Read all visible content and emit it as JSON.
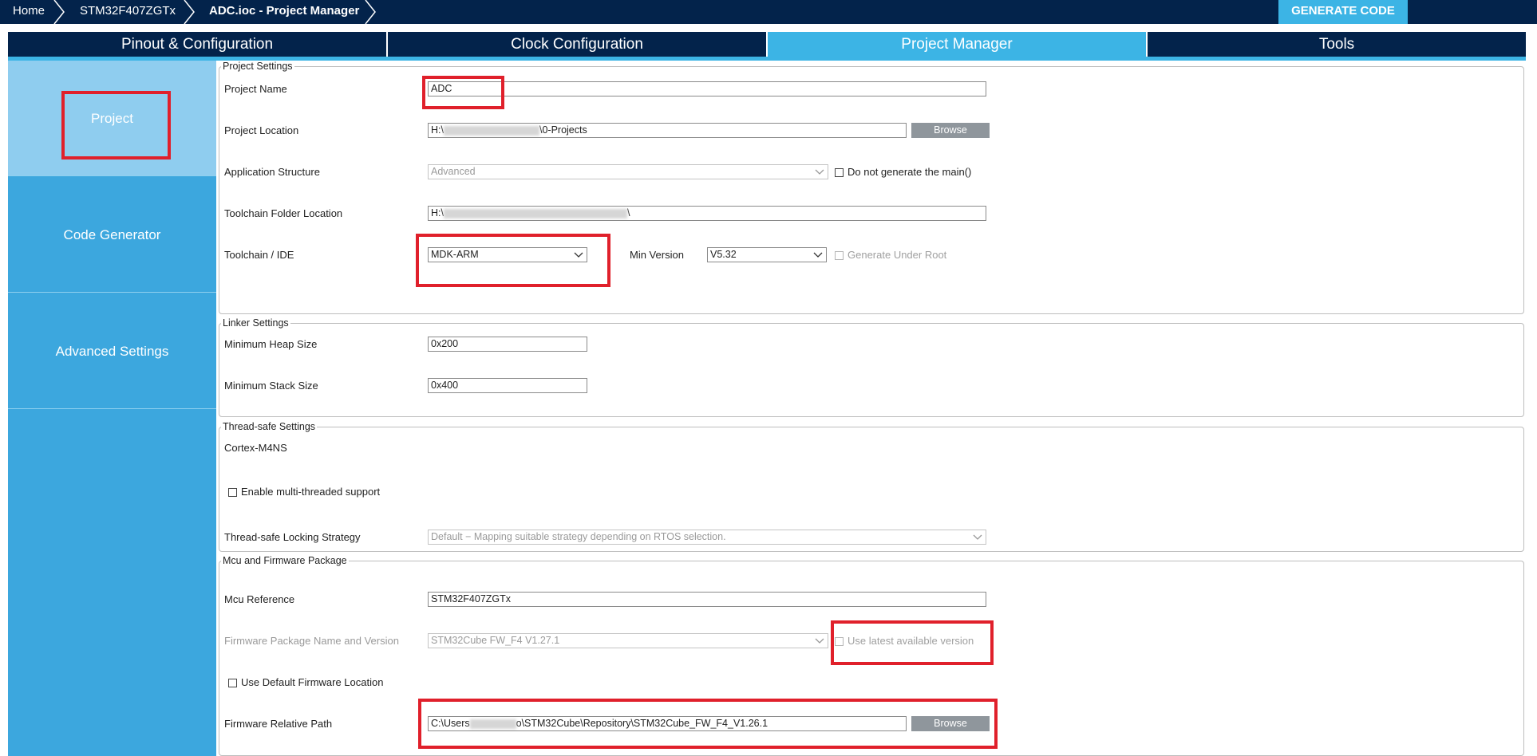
{
  "breadcrumb": {
    "home": "Home",
    "device": "STM32F407ZGTx",
    "current": "ADC.ioc - Project Manager"
  },
  "generate_button": "GENERATE CODE",
  "tabs": [
    "Pinout & Configuration",
    "Clock Configuration",
    "Project Manager",
    "Tools"
  ],
  "active_tab": "Project Manager",
  "nav": {
    "items": [
      "Project",
      "Code Generator",
      "Advanced Settings"
    ],
    "active": "Project"
  },
  "colors": {
    "dark_navy": "#03234b",
    "accent_blue": "#3cb4e5",
    "nav_active": "#8fcdef",
    "highlight_red": "#e0202b"
  },
  "project_settings": {
    "legend": "Project Settings",
    "project_name_label": "Project Name",
    "project_name_value": "ADC",
    "project_location_label": "Project Location",
    "project_location_prefix": "H:\\",
    "project_location_suffix": "\\0-Projects",
    "browse_label": "Browse",
    "app_structure_label": "Application Structure",
    "app_structure_value": "Advanced",
    "do_not_generate_main": "Do not generate the main()",
    "toolchain_folder_label": "Toolchain Folder Location",
    "toolchain_folder_prefix": "H:\\",
    "toolchain_folder_suffix": "\\",
    "toolchain_label": "Toolchain / IDE",
    "toolchain_value": "MDK-ARM",
    "min_version_label": "Min Version",
    "min_version_value": "V5.32",
    "generate_under_root": "Generate Under Root"
  },
  "linker_settings": {
    "legend": "Linker Settings",
    "heap_label": "Minimum Heap Size",
    "heap_value": "0x200",
    "stack_label": "Minimum Stack Size",
    "stack_value": "0x400"
  },
  "thread_safe": {
    "legend": "Thread-safe Settings",
    "core": "Cortex-M4NS",
    "enable_multithread": "Enable multi-threaded support",
    "locking_label": "Thread-safe Locking Strategy",
    "locking_value": "Default  −  Mapping suitable strategy depending on RTOS selection."
  },
  "mcu_firmware": {
    "legend": "Mcu and Firmware Package",
    "mcu_ref_label": "Mcu Reference",
    "mcu_ref_value": "STM32F407ZGTx",
    "fw_package_label": "Firmware Package Name and Version",
    "fw_package_value": "STM32Cube FW_F4 V1.27.1",
    "use_latest": "Use latest available version",
    "use_default_location": "Use Default Firmware Location",
    "fw_path_label": "Firmware Relative Path",
    "fw_path_prefix": "C:\\Users",
    "fw_path_suffix": "o\\STM32Cube\\Repository\\STM32Cube_FW_F4_V1.26.1",
    "browse_label": "Browse"
  }
}
